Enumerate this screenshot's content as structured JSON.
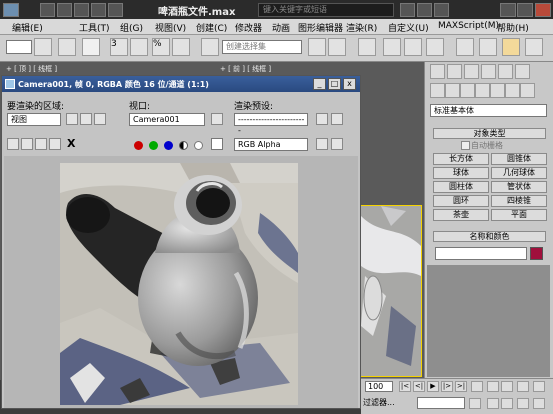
{
  "app": {
    "file_title": "啤酒瓶文件.max",
    "search_placeholder": "键入关键字或短语"
  },
  "menu": [
    "编辑(E)",
    "工具(T)",
    "组(G)",
    "视图(V)",
    "创建(C)",
    "修改器",
    "动画",
    "图形编辑器",
    "渲染(R)",
    "自定义(U)",
    "MAXScript(M)",
    "帮助(H)"
  ],
  "toolbar": {
    "selection_set_placeholder": "创建选择集",
    "snap_label": "3",
    "angle_snap_label": "%"
  },
  "viewport_labels": {
    "top_left": "+ [ 顶 ] [ 线框 ]",
    "top_center": "+ [ 前 ] [ 线框 ]"
  },
  "render_window": {
    "title": "Camera001, 帧 0, RGBA 颜色 16 位/通道 (1:1)",
    "area_label": "要渲染的区域:",
    "area_value": "视图",
    "viewport_label": "视口:",
    "viewport_value": "Camera001",
    "preset_label": "渲染预设:",
    "preset_value": "------------------------",
    "channel_value": "RGB Alpha",
    "close_glyph": "X"
  },
  "command_panel": {
    "category_value": "标准基本体",
    "object_type_header": "对象类型",
    "autogrid_label": "自动栅格",
    "primitives": [
      "长方体",
      "圆锥体",
      "球体",
      "几何球体",
      "圆柱体",
      "管状体",
      "圆环",
      "四棱锥",
      "茶壶",
      "平面"
    ],
    "name_color_header": "名称和颜色",
    "object_color": "#a0103c"
  },
  "bottom": {
    "frame_value": "100",
    "filter_label": "过滤器..."
  },
  "colors": {
    "titlebar": "#2b2b2b",
    "render_titlebar": "#3a5f9c",
    "red_channel": "#cc0000",
    "green_channel": "#00aa00",
    "blue_channel": "#0000cc"
  }
}
